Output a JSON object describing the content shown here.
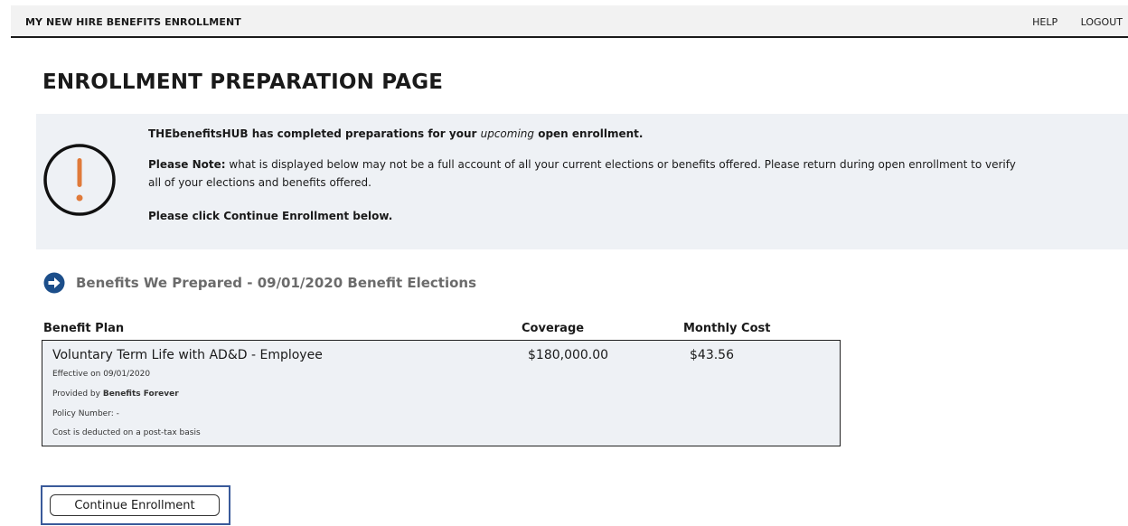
{
  "header": {
    "app_title": "MY NEW HIRE BENEFITS ENROLLMENT",
    "help_label": "HELP",
    "logout_label": "LOGOUT"
  },
  "page": {
    "title": "ENROLLMENT PREPARATION PAGE"
  },
  "notice": {
    "line1_prefix": "THEbenefitsHUB has completed preparations for your ",
    "line1_emphasis": "upcoming",
    "line1_suffix": " open enrollment.",
    "note_label": "Please Note:",
    "note_text": " what is displayed below may not be a full account of all your current elections or benefits offered. Please return during open enrollment to verify all of your elections and benefits offered.",
    "instruction": "Please click Continue Enrollment below."
  },
  "section": {
    "title": "Benefits We Prepared - 09/01/2020 Benefit Elections"
  },
  "table": {
    "headers": {
      "plan": "Benefit Plan",
      "coverage": "Coverage",
      "cost": "Monthly Cost"
    },
    "rows": [
      {
        "plan_name": "Voluntary Term Life with AD&D - Employee",
        "effective": "Effective on 09/01/2020",
        "provided_prefix": "Provided by ",
        "provider": "Benefits Forever",
        "policy": "Policy Number: -",
        "tax_basis": "Cost is deducted on a post-tax basis",
        "coverage": "$180,000.00",
        "cost": "$43.56"
      }
    ]
  },
  "actions": {
    "continue_label": "Continue Enrollment"
  },
  "colors": {
    "notice_bg": "#eef1f5",
    "alert_orange": "#e07a3a",
    "arrow_blue": "#1c4e8a",
    "focus_border": "#3a5a9a"
  },
  "icons": {
    "alert": "exclamation-circle-icon",
    "section": "arrow-right-circle-icon"
  }
}
